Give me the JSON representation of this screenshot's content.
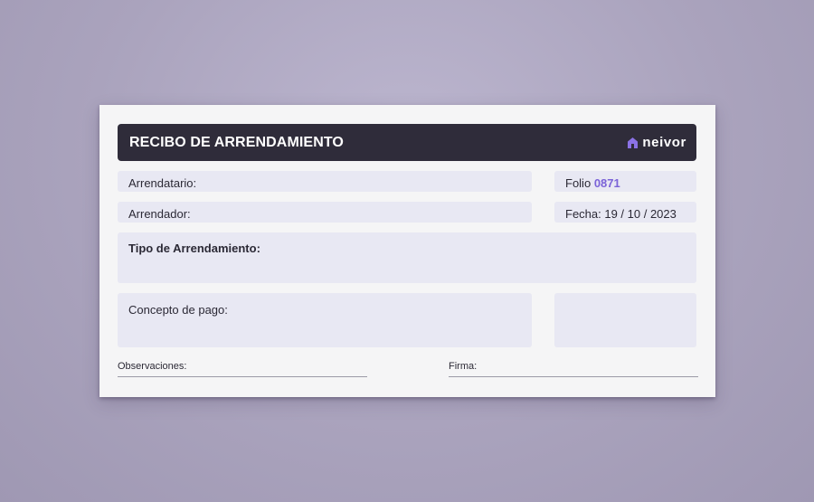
{
  "receipt": {
    "title": "RECIBO DE ARRENDAMIENTO",
    "brand": {
      "name": "neivor",
      "icon": "home-icon",
      "accent_color": "#8b72e6"
    },
    "arrendatario_label": "Arrendatario:",
    "arrendador_label": "Arrendador:",
    "folio_label": "Folio",
    "folio_number": "0871",
    "fecha": "Fecha: 19 / 10 / 2023",
    "tipo_label": "Tipo de Arrendamiento:",
    "concepto_label": "Concepto de pago:",
    "observaciones_label": "Observaciones:",
    "firma_label": "Firma:"
  }
}
